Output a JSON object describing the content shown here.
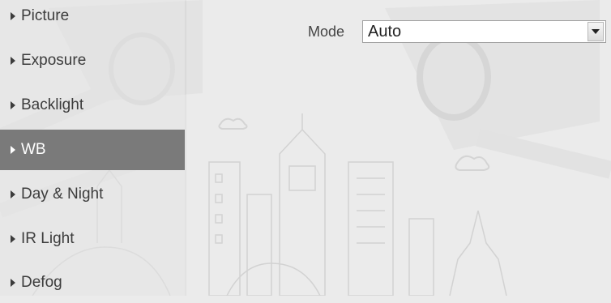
{
  "sidebar": {
    "items": [
      {
        "label": "Picture",
        "active": false
      },
      {
        "label": "Exposure",
        "active": false
      },
      {
        "label": "Backlight",
        "active": false
      },
      {
        "label": "WB",
        "active": true
      },
      {
        "label": "Day & Night",
        "active": false
      },
      {
        "label": "IR Light",
        "active": false
      },
      {
        "label": "Defog",
        "active": false
      }
    ]
  },
  "settings": {
    "mode_label": "Mode",
    "mode_value": "Auto"
  },
  "colors": {
    "background": "#ebebeb",
    "active_item": "#7a7a7a",
    "text": "#3c3c3c"
  },
  "icons": [
    "triangle-right-icon",
    "chevron-down-icon"
  ]
}
